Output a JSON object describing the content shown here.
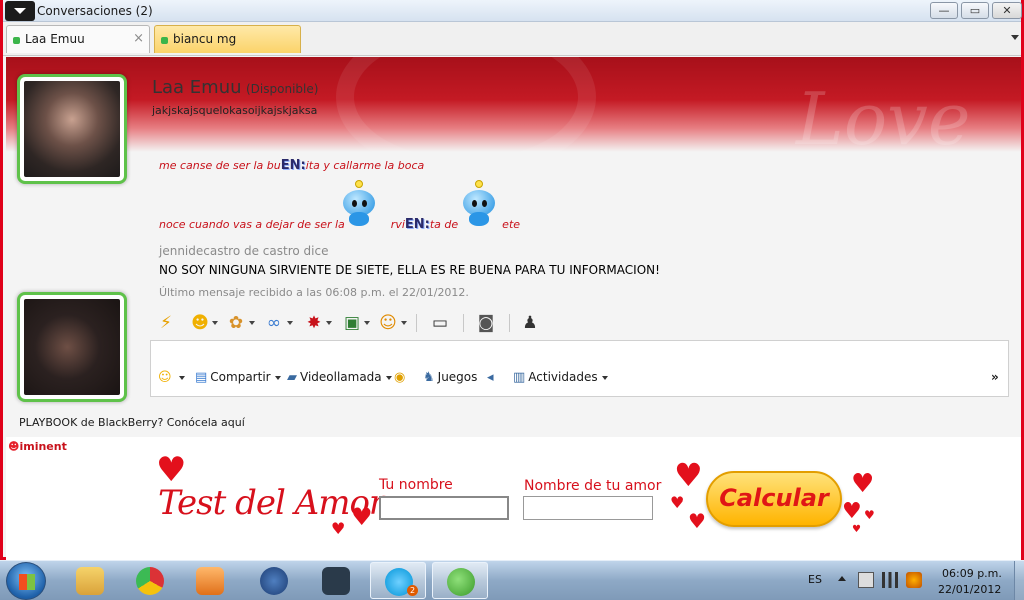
{
  "window": {
    "title": "Conversaciones (2)",
    "min_label": "—",
    "max_label": "▭",
    "close_label": "✕"
  },
  "tabs": [
    {
      "label": "Laa Emuu",
      "close_label": "×"
    },
    {
      "label": "biancu mg"
    }
  ],
  "contact": {
    "name": "Laa Emuu",
    "status": "(Disponible)",
    "personal_message": "jakjskajsquelokasoijkajskjaksa"
  },
  "banner": {
    "art_text": "Love"
  },
  "messages": {
    "line1_a": "me canse de ser la bu",
    "line1_en": "EN:",
    "line1_b": "ita y callarme la boca",
    "line2_a": "noce cuando vas a dejar de ser la",
    "line2_b": "rvi",
    "line2_en": "EN:",
    "line2_c": "ta de",
    "line2_d": "ete",
    "sender": "jennidecastro de castro dice",
    "sender_text": "NO SOY NINGUNA SIRVIENTE DE SIETE, ELLA ES RE BUENA PARA TU INFORMACION!",
    "last_received": "Último mensaje recibido a las 06:08 p.m. el 22/01/2012."
  },
  "toolbar_icons": [
    "nudge-icon",
    "smiley-icon",
    "wink-emoticon-icon",
    "glasses-icon",
    "dynamite-icon",
    "video-clip-icon",
    "winks-icon",
    "tv-icon",
    "gamepad-icon",
    "add-contact-icon"
  ],
  "input_bar": {
    "share": "Compartir",
    "videocall": "Videollamada",
    "games": "Juegos",
    "activities": "Actividades",
    "more": "»"
  },
  "promo": "PLAYBOOK de BlackBerry? Conócela aquí",
  "ad": {
    "brand": "iminent",
    "title": "Test del Amor",
    "label_name": "Tu nombre",
    "label_love": "Nombre de tu amor",
    "button": "Calcular",
    "name_value": "",
    "love_value": ""
  },
  "taskbar": {
    "lang": "ES",
    "time": "06:09 p.m.",
    "date": "22/01/2012",
    "skype_badge": "2"
  },
  "colors": {
    "frame_red": "#e0001a",
    "message_red": "#c8121b",
    "avatar_green": "#5fc24a",
    "button_yellow": "#ffb400"
  }
}
